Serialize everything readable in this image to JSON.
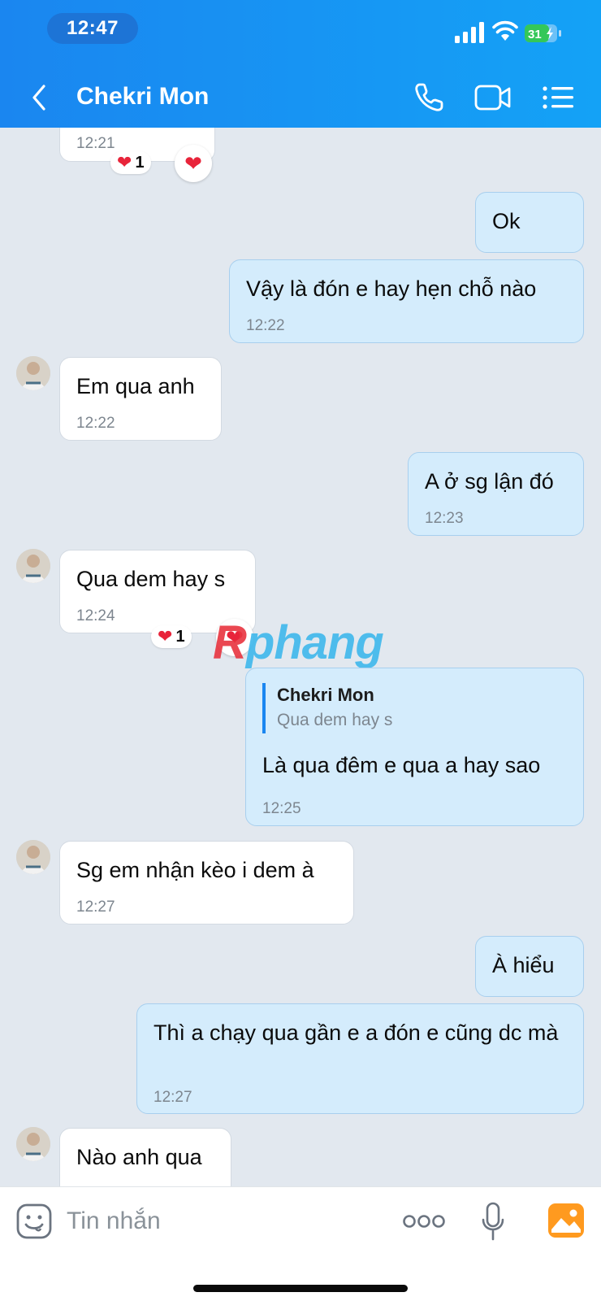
{
  "status_bar": {
    "time": "12:47",
    "battery": "31"
  },
  "header": {
    "title": "Chekri Mon"
  },
  "messages": [
    {
      "time": "12:21",
      "reaction_count": "1"
    },
    {
      "text": "Ok"
    },
    {
      "text": "Vậy là đón e hay hẹn chỗ nào",
      "time": "12:22"
    },
    {
      "text": "Em qua anh",
      "time": "12:22"
    },
    {
      "text": "A ở sg lận đó",
      "time": "12:23"
    },
    {
      "text": "Qua dem hay s",
      "time": "12:24",
      "reaction_count": "1"
    },
    {
      "quote_name": "Chekri Mon",
      "quote_text": "Qua dem hay s",
      "text": "Là qua đêm e qua a hay sao",
      "time": "12:25"
    },
    {
      "text": "Sg em nhận kèo i dem à",
      "time": "12:27"
    },
    {
      "text": "À hiểu"
    },
    {
      "text": "Thì a chạy qua gần e a đón e cũng dc mà",
      "time": "12:27"
    },
    {
      "text": "Nào anh qua"
    }
  ],
  "watermark": {
    "first": "R",
    "rest": "phang"
  },
  "input": {
    "placeholder": "Tin nhắn"
  },
  "colors": {
    "header": "#1a86f0",
    "outgoing_bubble": "#d4ecfc",
    "incoming_bubble": "#ffffff",
    "chat_bg": "#e2e8ef"
  }
}
